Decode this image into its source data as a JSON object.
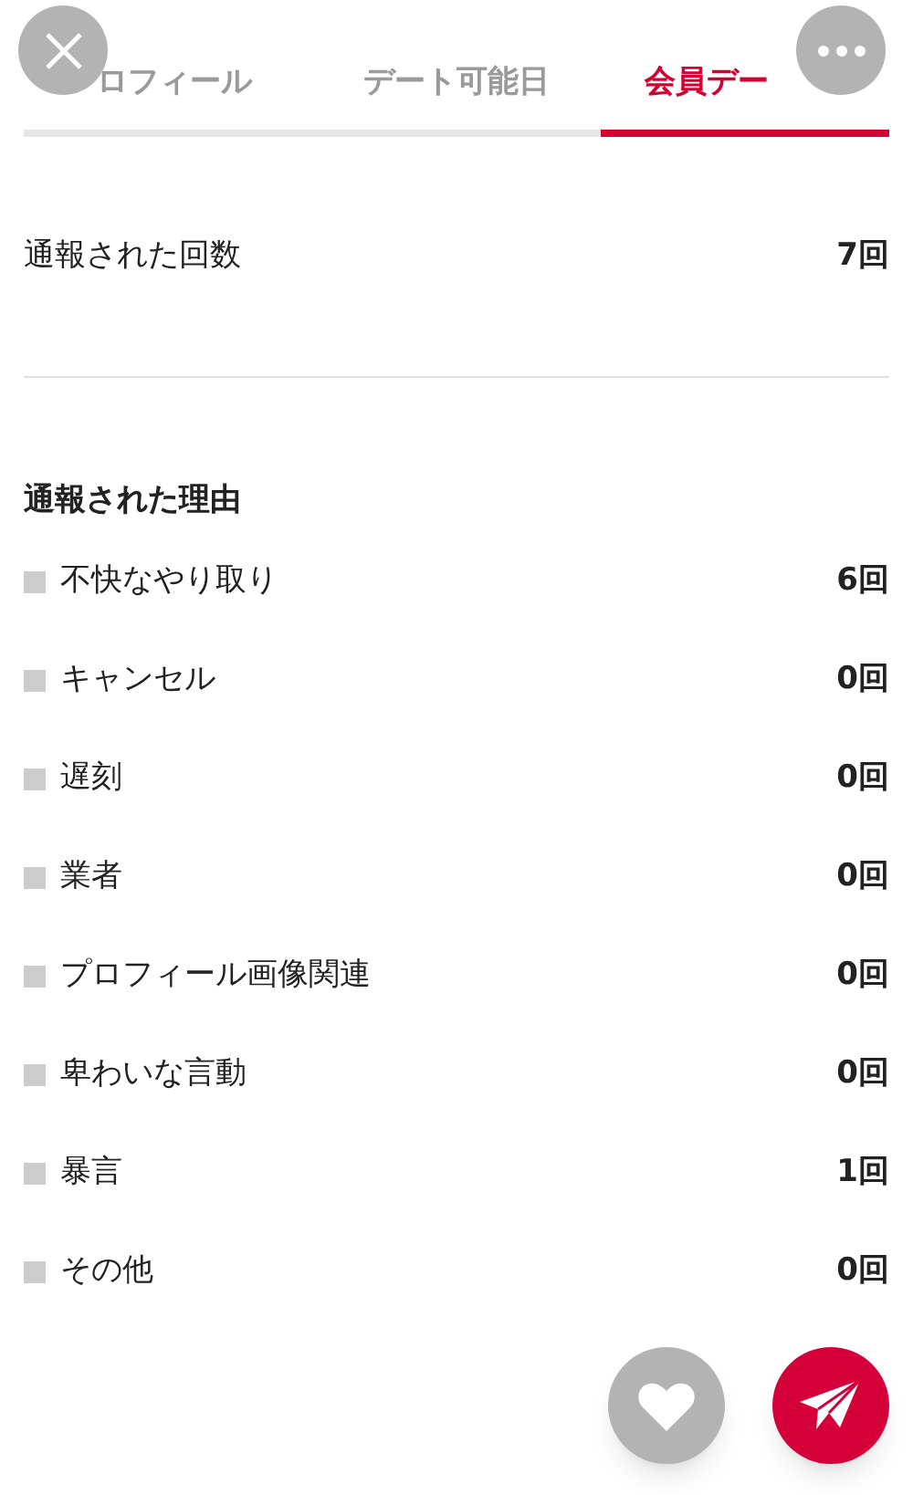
{
  "tabs": [
    {
      "label": "ロフィール",
      "selected": false
    },
    {
      "label": "デート可能日",
      "selected": false
    },
    {
      "label": "会員デー",
      "selected": true
    }
  ],
  "report_count": {
    "label": "通報された回数",
    "value": "7回"
  },
  "reasons": {
    "heading": "通報された理由",
    "items": [
      {
        "label": "不快なやり取り",
        "value": "6回"
      },
      {
        "label": "キャンセル",
        "value": "0回"
      },
      {
        "label": "遅刻",
        "value": "0回"
      },
      {
        "label": "業者",
        "value": "0回"
      },
      {
        "label": "プロフィール画像関連",
        "value": "0回"
      },
      {
        "label": "卑わいな言動",
        "value": "0回"
      },
      {
        "label": "暴言",
        "value": "1回"
      },
      {
        "label": "その他",
        "value": "0回"
      }
    ]
  }
}
